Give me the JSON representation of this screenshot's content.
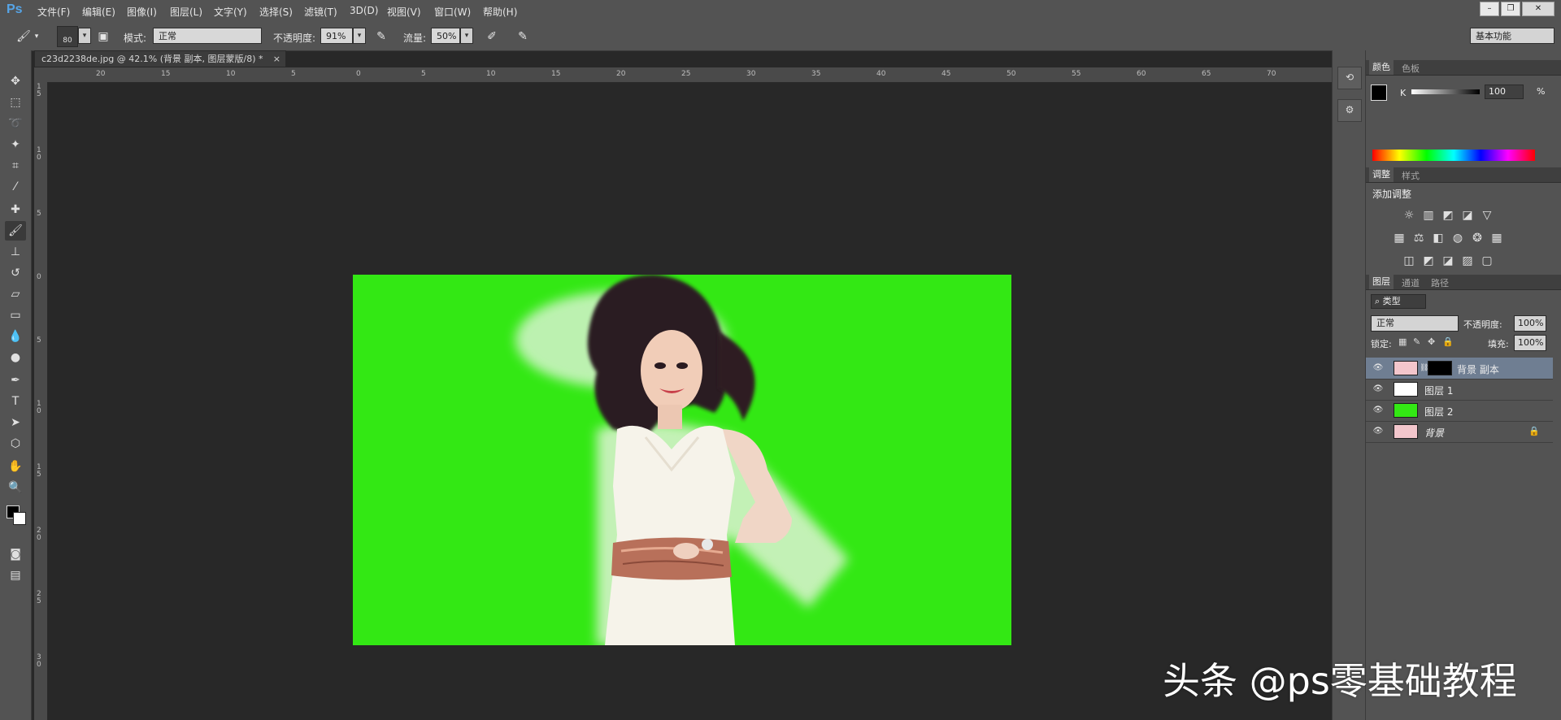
{
  "app": {
    "logo": "Ps"
  },
  "menu": [
    "文件(F)",
    "编辑(E)",
    "图像(I)",
    "图层(L)",
    "文字(Y)",
    "选择(S)",
    "滤镜(T)",
    "3D(D)",
    "视图(V)",
    "窗口(W)",
    "帮助(H)"
  ],
  "window_controls": {
    "minimize": "–",
    "restore": "❐",
    "close": "✕"
  },
  "options": {
    "brush_size": "80",
    "mode_label": "模式:",
    "mode_value": "正常",
    "opacity_label": "不透明度:",
    "opacity_value": "91%",
    "flow_label": "流量:",
    "flow_value": "50%",
    "workspace": "基本功能"
  },
  "document": {
    "tab_title": "c23d2238de.jpg @ 42.1% (背景 副本, 图层蒙版/8) *",
    "close": "×"
  },
  "hruler_ticks": [
    "20",
    "15",
    "10",
    "5",
    "0",
    "5",
    "10",
    "15",
    "20",
    "25",
    "30",
    "35",
    "40",
    "45",
    "50",
    "55",
    "60",
    "65",
    "70"
  ],
  "vruler_ticks": [
    "1\n5",
    "1\n0",
    "5",
    "0",
    "5",
    "1\n0",
    "1\n5",
    "2\n0",
    "2\n5",
    "3\n0"
  ],
  "color_panel": {
    "tabs": [
      "颜色",
      "色板"
    ],
    "channel": "K",
    "value": "100",
    "unit": "%"
  },
  "adjust_panel": {
    "tabs": [
      "调整",
      "样式"
    ],
    "title": "添加调整"
  },
  "layers_panel": {
    "tabs": [
      "图层",
      "通道",
      "路径"
    ],
    "filter_label": "类型",
    "blend_mode": "正常",
    "opacity_label": "不透明度:",
    "opacity_value": "100%",
    "lock_label": "锁定:",
    "fill_label": "填充:",
    "fill_value": "100%",
    "layers": [
      {
        "name": "背景 副本",
        "selected": true
      },
      {
        "name": "图层 1",
        "selected": false
      },
      {
        "name": "图层 2",
        "selected": false
      },
      {
        "name": "背景",
        "selected": false
      }
    ]
  },
  "colors": {
    "canvas_green": "#33e814",
    "bg": "#282828",
    "panel": "#535353"
  },
  "watermark": "头条 @ps零基础教程"
}
